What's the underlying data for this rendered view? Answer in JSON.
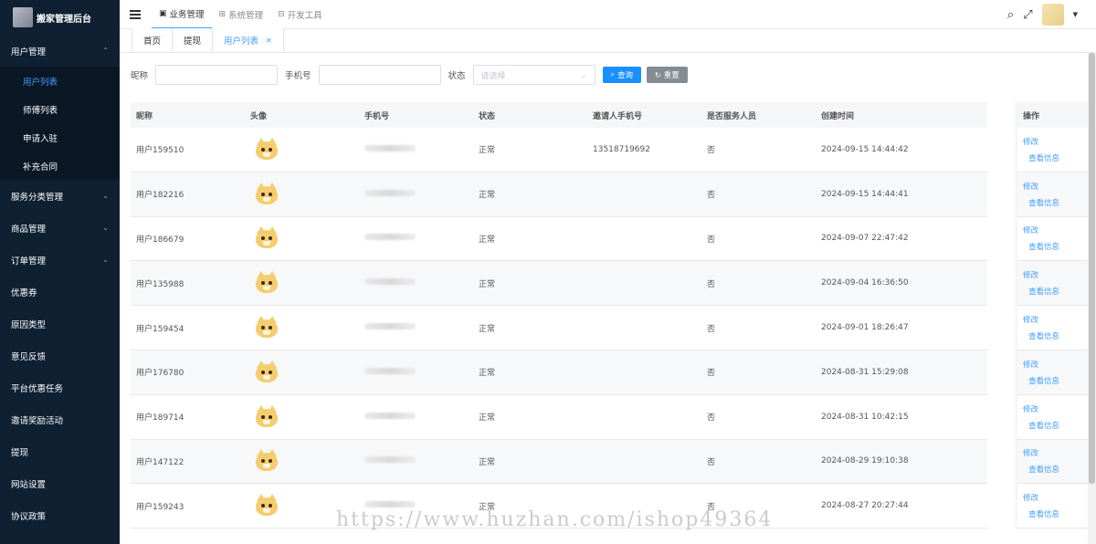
{
  "sidebar": {
    "logo_text": "搬家管理后台",
    "menu": [
      {
        "label": "用户管理",
        "expanded": true,
        "children": [
          "用户列表",
          "师傅列表",
          "申请入驻",
          "补充合同"
        ],
        "active_child": 0
      },
      {
        "label": "服务分类管理",
        "has_children": true
      },
      {
        "label": "商品管理",
        "has_children": true
      },
      {
        "label": "订单管理",
        "has_children": true
      },
      {
        "label": "优惠券"
      },
      {
        "label": "原因类型"
      },
      {
        "label": "意见反馈"
      },
      {
        "label": "平台优惠任务"
      },
      {
        "label": "邀请奖励活动"
      },
      {
        "label": "提现"
      },
      {
        "label": "网站设置"
      },
      {
        "label": "协议政策"
      }
    ]
  },
  "topnav": {
    "items": [
      "业务管理",
      "系统管理",
      "开发工具"
    ],
    "active": 0
  },
  "tabs": {
    "items": [
      "首页",
      "提现",
      "用户列表"
    ],
    "active": 2
  },
  "filters": {
    "nickname_label": "昵称",
    "phone_label": "手机号",
    "status_label": "状态",
    "status_placeholder": "请选择",
    "search_button": "查询",
    "reset_button": "重置"
  },
  "table": {
    "columns": [
      "昵称",
      "头像",
      "手机号",
      "状态",
      "邀请人手机号",
      "是否服务人员",
      "创建时间"
    ],
    "action_column": "操作",
    "rows": [
      {
        "nickname": "用户159510",
        "status": "正常",
        "inviter_phone": "13518719692",
        "is_service": "否",
        "created": "2024-09-15 14:44:42"
      },
      {
        "nickname": "用户182216",
        "status": "正常",
        "inviter_phone": "",
        "is_service": "否",
        "created": "2024-09-15 14:44:41"
      },
      {
        "nickname": "用户186679",
        "status": "正常",
        "inviter_phone": "",
        "is_service": "否",
        "created": "2024-09-07 22:47:42"
      },
      {
        "nickname": "用户135988",
        "status": "正常",
        "inviter_phone": "",
        "is_service": "否",
        "created": "2024-09-04 16:36:50"
      },
      {
        "nickname": "用户159454",
        "status": "正常",
        "inviter_phone": "",
        "is_service": "否",
        "created": "2024-09-01 18:26:47"
      },
      {
        "nickname": "用户176780",
        "status": "正常",
        "inviter_phone": "",
        "is_service": "否",
        "created": "2024-08-31 15:29:08"
      },
      {
        "nickname": "用户189714",
        "status": "正常",
        "inviter_phone": "",
        "is_service": "否",
        "created": "2024-08-31 10:42:15"
      },
      {
        "nickname": "用户147122",
        "status": "正常",
        "inviter_phone": "",
        "is_service": "否",
        "created": "2024-08-29 19:10:38"
      },
      {
        "nickname": "用户159243",
        "status": "正常",
        "inviter_phone": "",
        "is_service": "否",
        "created": "2024-08-27 20:27:44"
      }
    ],
    "action_edit": "修改",
    "action_view": "查看信息"
  },
  "watermark": "https://www.huzhan.com/ishop49364",
  "colors": {
    "sidebar_bg": "#0f2033",
    "accent": "#409eff",
    "primary_button": "#1890ff"
  }
}
